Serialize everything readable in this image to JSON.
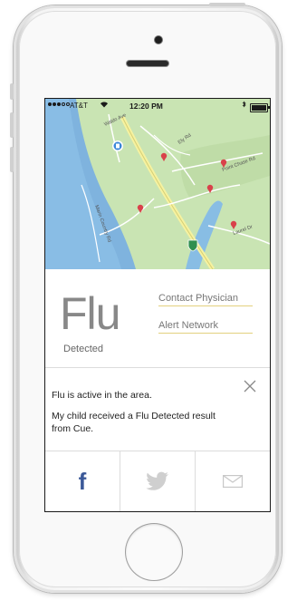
{
  "status_bar": {
    "carrier": "AT&T",
    "time": "12:20 PM",
    "wifi_icon": "wifi-icon",
    "bluetooth_icon": "bluetooth-icon",
    "battery_icon": "battery-icon"
  },
  "map": {
    "street_labels": [
      "Waldo Ave",
      "Ely Rd",
      "Point Chase Rd",
      "Marin Country Rd",
      "Laurel Dr"
    ],
    "pin_color": "#d9414a",
    "current_location_icon": "location-marker-icon",
    "highway_shield_icon": "highway-shield-icon"
  },
  "result": {
    "condition": "Flu",
    "status": "Detected",
    "contact_label": "Contact Physician",
    "alert_label": "Alert Network",
    "link_underline_color": "#e3d17e"
  },
  "message": {
    "line1": "Flu is active in the area.",
    "line2": "My child received a Flu Detected result from Cue.",
    "close_icon": "close-icon"
  },
  "share": {
    "facebook_icon": "facebook-icon",
    "twitter_icon": "twitter-icon",
    "mail_icon": "mail-icon",
    "facebook_color": "#3b5998",
    "inactive_color": "#cfcfcf"
  }
}
